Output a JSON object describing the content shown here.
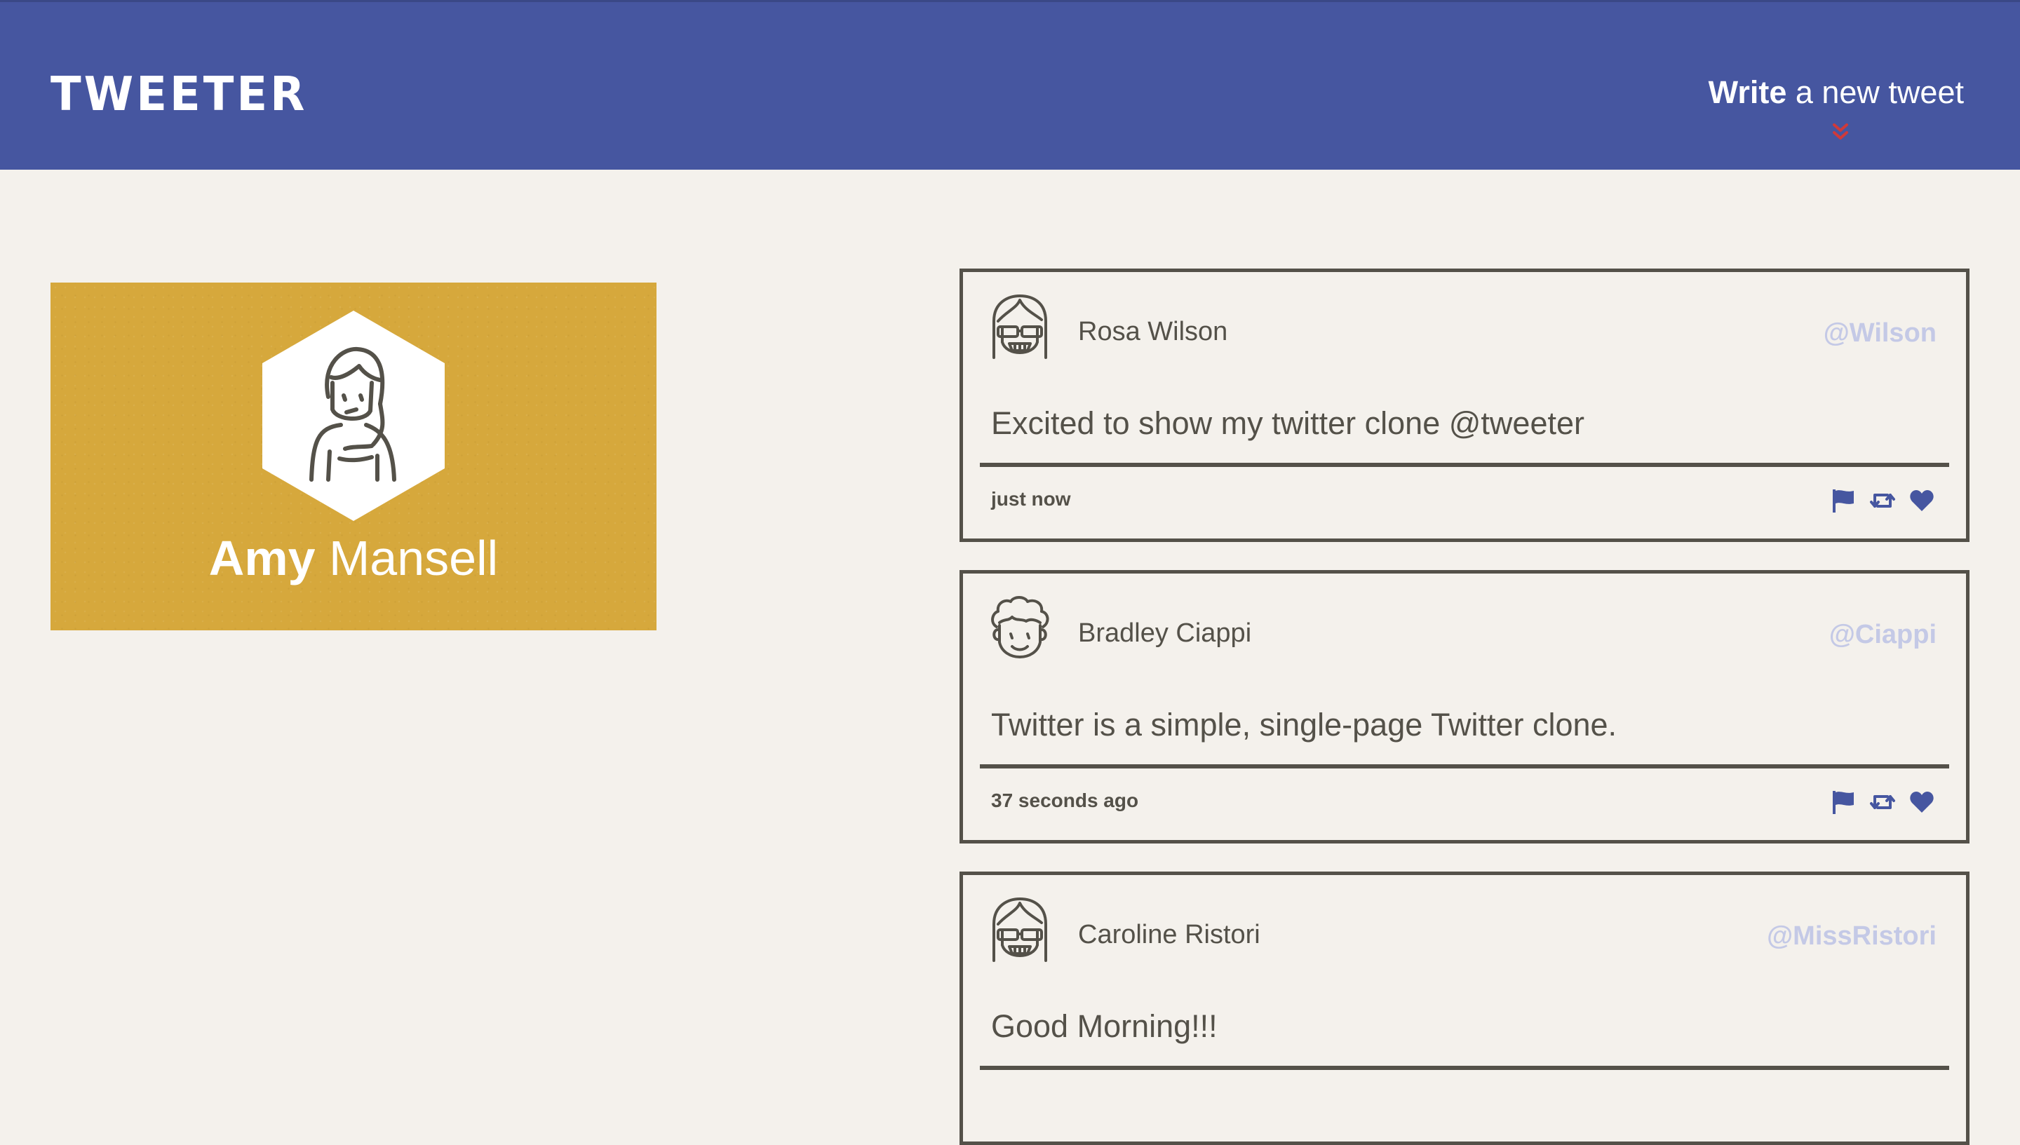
{
  "header": {
    "logo": "TWEETER",
    "compose_bold": "Write",
    "compose_rest": " a new tweet",
    "compose_arrow_icon": "double-chevron-down-icon",
    "bar_color": "#4656a0",
    "arrow_color": "#d0393a"
  },
  "profile": {
    "first_name": "Amy",
    "last_name": "Mansell",
    "avatar_icon": "girl-avatar-icon",
    "card_color": "#d6a83c"
  },
  "tweets": [
    {
      "name": "Rosa Wilson",
      "handle": "@Wilson",
      "content": "Excited to show my twitter clone @tweeter",
      "time": "just now",
      "avatar_icon": "sunglasses-avatar-icon"
    },
    {
      "name": "Bradley Ciappi",
      "handle": "@Ciappi",
      "content": "Twitter is a simple, single-page Twitter clone.",
      "time": "37 seconds ago",
      "avatar_icon": "curly-hair-avatar-icon"
    },
    {
      "name": "Caroline Ristori",
      "handle": "@MissRistori",
      "content": "Good Morning!!!",
      "time": "",
      "avatar_icon": "sunglasses-avatar-icon"
    }
  ],
  "tweet_actions": [
    "flag-icon",
    "retweet-icon",
    "heart-icon"
  ],
  "colors": {
    "page_background": "#f4f1ec",
    "text_dark": "#545149",
    "handle": "#c4c9e6",
    "action_icons": "#4656a0"
  }
}
